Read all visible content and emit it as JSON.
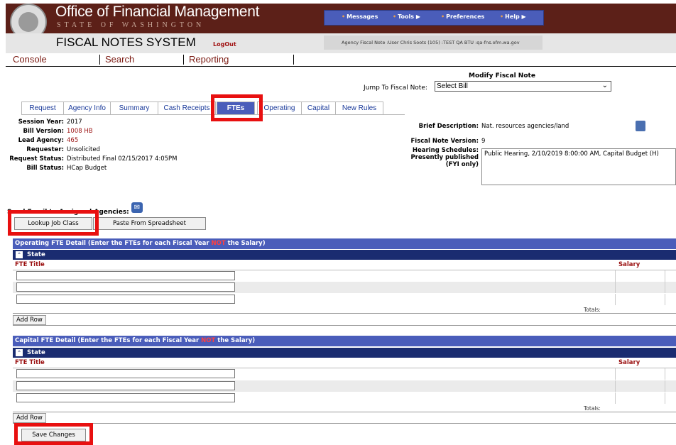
{
  "header": {
    "org_title": "Office of Financial Management",
    "org_subtitle": "STATE OF WASHINGTON",
    "system_title": "FISCAL NOTES SYSTEM",
    "logout": "LogOut",
    "agency_line": "Agency Fiscal Note :User Chris Soots (105) :TEST QA BTU :qa-fns.ofm.wa.gov",
    "nav": [
      {
        "label": "Messages",
        "icon": "bullet-icon"
      },
      {
        "label": "Tools",
        "icon": "arrow-right-icon"
      },
      {
        "label": "Preferences",
        "icon": "bullet-icon"
      },
      {
        "label": "Help",
        "icon": "arrow-right-icon"
      }
    ],
    "colors": {
      "brand": "#5c2018",
      "nav": "#4a5dba",
      "highlight": "#e81010"
    }
  },
  "menu": [
    "Console",
    "Search",
    "Reporting"
  ],
  "page": {
    "title": "Modify Fiscal Note",
    "jump_label": "Jump To Fiscal Note:",
    "jump_value": "Select Bill"
  },
  "tabs": [
    {
      "label": "Request"
    },
    {
      "label": "Agency Info"
    },
    {
      "label": "Summary"
    },
    {
      "label": "Cash Receipts"
    },
    {
      "label": "FTEs",
      "active": true
    },
    {
      "label": "Operating"
    },
    {
      "label": "Capital"
    },
    {
      "label": "New Rules"
    }
  ],
  "info": {
    "session_year_label": "Session Year:",
    "session_year": "2017",
    "bill_version_label": "Bill Version:",
    "bill_version": "1008 HB",
    "lead_agency_label": "Lead Agency:",
    "lead_agency": "465",
    "requester_label": "Requester:",
    "requester": "Unsolicited",
    "request_status_label": "Request Status:",
    "request_status": "Distributed Final 02/15/2017 4:05PM",
    "bill_status_label": "Bill Status:",
    "bill_status": "HCap Budget",
    "brief_desc_label": "Brief Description:",
    "brief_desc": "Nat. resources agencies/land",
    "fn_version_label": "Fiscal Note Version:",
    "fn_version": "9",
    "hearing_label_1": "Hearing Schedules:",
    "hearing_label_2": "Presently published",
    "hearing_label_3": "(FYI only)",
    "hearing_value": "Public Hearing, 2/10/2019 8:00:00 AM, Capital Budget (H)"
  },
  "email_label": "Send Email to Assigned Agencies:",
  "buttons": {
    "lookup": "Lookup Job Class",
    "paste": "Paste From Spreadsheet",
    "save": "Save Changes",
    "add_row": "Add Row"
  },
  "operating": {
    "title_pre": "Operating FTE Detail (Enter the FTEs for each Fiscal Year ",
    "title_not": "NOT",
    "title_post": " the Salary)",
    "state": "State",
    "col_fte": "FTE Title",
    "col_salary": "Salary",
    "totals": "Totals:"
  },
  "capital": {
    "title_pre": "Capital FTE Detail (Enter the FTEs for each Fiscal Year ",
    "title_not": "NOT",
    "title_post": " the Salary)",
    "state": "State",
    "col_fte": "FTE Title",
    "col_salary": "Salary",
    "totals": "Totals:"
  }
}
